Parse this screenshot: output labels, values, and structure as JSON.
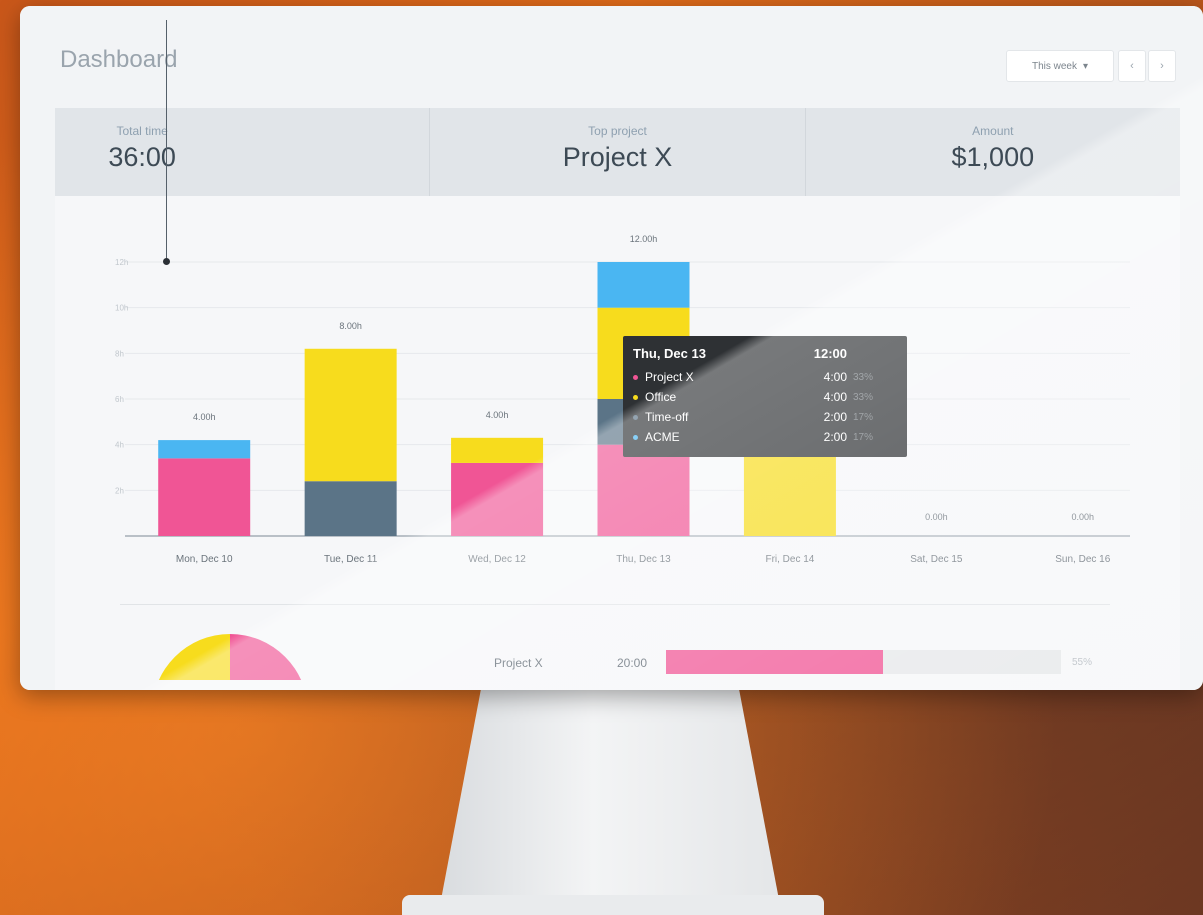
{
  "header": {
    "title": "Dashboard",
    "week_select": "This week",
    "prev_icon": "chevron-left-icon",
    "next_icon": "chevron-right-icon"
  },
  "stats": [
    {
      "label": "Total time",
      "value": "36:00"
    },
    {
      "label": "Top project",
      "value": "Project X"
    },
    {
      "label": "Amount",
      "value": "$1,000"
    }
  ],
  "colors": {
    "project_x": "#f05595",
    "office": "#5b7487",
    "time_off": "#f7dc1d",
    "acme": "#4ab6f2"
  },
  "chart_data": {
    "type": "bar",
    "stacked": true,
    "categories": [
      "Mon, Dec 10",
      "Tue, Dec 11",
      "Wed, Dec 12",
      "Thu, Dec 13",
      "Fri, Dec 14",
      "Sat, Dec 15",
      "Sun, Dec 16"
    ],
    "totals_labels": [
      "4.00h",
      "8.00h",
      "4.00h",
      "12.00h",
      "",
      "0.00h",
      "0.00h"
    ],
    "ytick_labels": [
      "12h",
      "10h",
      "8h",
      "6h",
      "4h",
      "2h"
    ],
    "ylim": [
      0,
      12
    ],
    "series": [
      {
        "name": "Project X",
        "values": [
          3.4,
          0,
          3.2,
          4,
          0,
          0,
          0
        ],
        "color": "#f05595"
      },
      {
        "name": "Office",
        "values": [
          0,
          2.4,
          0,
          2,
          0,
          0,
          0
        ],
        "color": "#5b7487"
      },
      {
        "name": "Time-off",
        "values": [
          0,
          5.8,
          1.1,
          4,
          4,
          0,
          0
        ],
        "color": "#f7dc1d"
      },
      {
        "name": "ACME",
        "values": [
          0.8,
          0,
          0,
          2,
          0,
          0,
          0
        ],
        "color": "#4ab6f2"
      }
    ]
  },
  "tooltip": {
    "date": "Thu, Dec 13",
    "total": "12:00",
    "rows": [
      {
        "name": "Project X",
        "value": "4:00",
        "pct": "33%"
      },
      {
        "name": "Office",
        "value": "4:00",
        "pct": "33%"
      },
      {
        "name": "Time-off",
        "value": "2:00",
        "pct": "17%"
      },
      {
        "name": "ACME",
        "value": "2:00",
        "pct": "17%"
      }
    ]
  },
  "projects": [
    {
      "name": "Project X",
      "time": "20:00",
      "fraction": 0.55,
      "pct": "55%"
    }
  ]
}
